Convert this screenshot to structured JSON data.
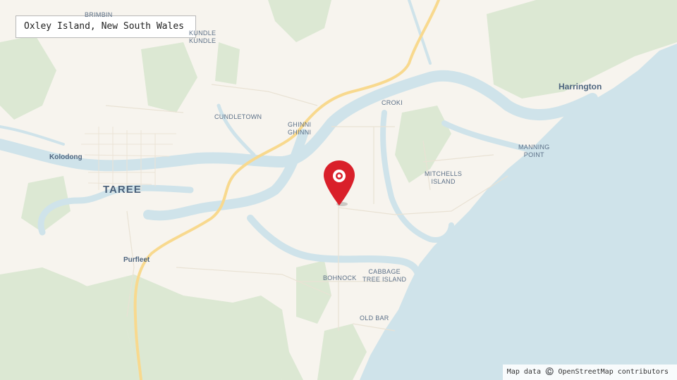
{
  "map": {
    "title": "Oxley Island, New South Wales",
    "attribution": "Map data ©️ OpenStreetMap contributors",
    "marker": {
      "icon": "location-pin-icon",
      "color": "#d9202a"
    },
    "colors": {
      "land": "#f7f4ee",
      "water": "#cfe3ea",
      "forest": "#dce8d3",
      "road": "#f8d98e"
    },
    "places": {
      "brimbin": "BRIMBIN",
      "kundle_kundle": "KUNDLE\nKUNDLE",
      "cundletown": "CUNDLETOWN",
      "ghinni_ghinni": "GHINNI\nGHINNI",
      "croki": "CROKI",
      "harrington": "Harrington",
      "manning_point": "MANNING\nPOINT",
      "mitchells_island": "MITCHELLS\nISLAND",
      "kolodong": "Kolodong",
      "taree": "TAREE",
      "purfleet": "Purfleet",
      "bohnock": "BOHNOCK",
      "cabbage_tree_island": "CABBAGE\nTREE ISLAND",
      "old_bar": "OLD BAR"
    }
  }
}
